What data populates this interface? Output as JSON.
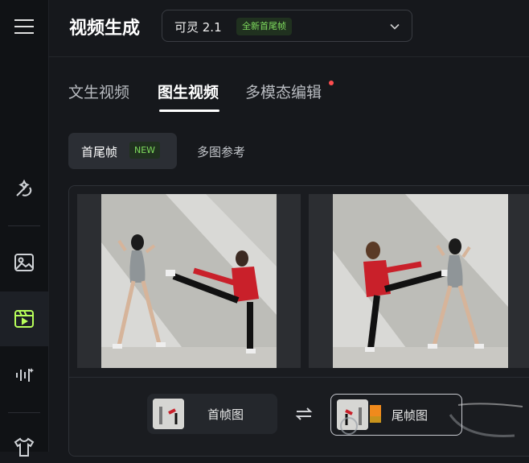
{
  "sidebar": {
    "icons": [
      "menu-icon",
      "magic-wand-icon",
      "image-icon",
      "video-icon",
      "audio-wave-icon",
      "shirt-icon"
    ]
  },
  "header": {
    "title": "视频生成",
    "model": {
      "name": "可灵 2.1",
      "badge": "全新首尾帧"
    }
  },
  "tabs": [
    {
      "label": "文生视频",
      "active": false
    },
    {
      "label": "图生视频",
      "active": true
    },
    {
      "label": "多模态编辑",
      "active": false,
      "dot": true
    }
  ],
  "subtabs": [
    {
      "label": "首尾帧",
      "badge": "NEW",
      "active": true
    },
    {
      "label": "多图参考",
      "active": false
    }
  ],
  "frames": {
    "first_label": "首帧图",
    "last_label": "尾帧图"
  },
  "colors": {
    "accent_green": "#7fdc5e",
    "notification_red": "#ff4d4f",
    "active_icon": "#b8ff5a"
  }
}
